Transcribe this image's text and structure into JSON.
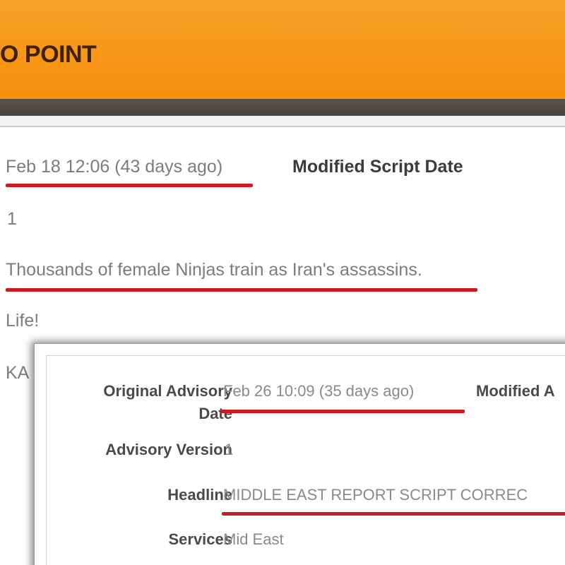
{
  "header": {
    "title": "O POINT"
  },
  "script_view": {
    "date_value": "Feb 18 12:06 (43 days ago)",
    "modified_label": "Modified Script Date",
    "version_value": "1",
    "headline_value": "Thousands of female Ninjas train as Iran's assassins.",
    "services_value": "Life!",
    "truncated_value": "KA"
  },
  "advisory_dialog": {
    "original_date_label_line1": "Original Advisory",
    "original_date_label_line2": "Date",
    "original_date_value": "Feb 26 10:09 (35 days ago)",
    "modified_label": "Modified A",
    "version_label": "Advisory Version",
    "version_value": "1",
    "headline_label": "Headline",
    "headline_value": "MIDDLE EAST REPORT SCRIPT CORREC",
    "services_label": "Services",
    "services_value": "Mid East"
  },
  "colors": {
    "header_orange": "#f79a1c",
    "header_band": "#4f4841",
    "underline_red": "#cc1a23"
  }
}
